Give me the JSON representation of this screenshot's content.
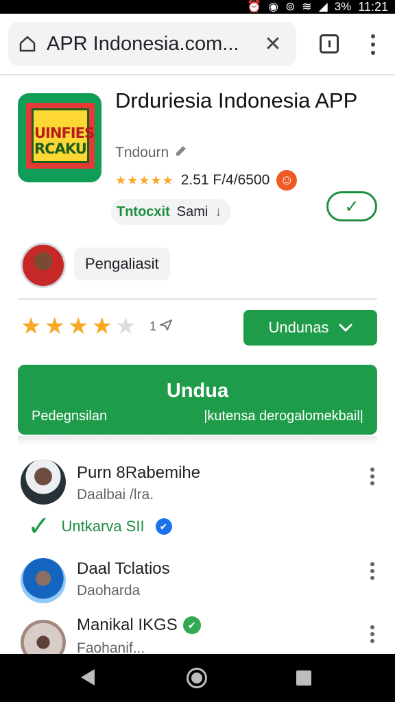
{
  "status_bar": {
    "time": "11:21",
    "battery": "3%",
    "icons": [
      "alarm-icon",
      "do-not-disturb-icon",
      "hotspot-icon",
      "wifi-icon",
      "signal-icon",
      "battery-icon"
    ]
  },
  "browser": {
    "url": "APR Indonesia.com...",
    "icons": [
      "home-icon",
      "close-icon",
      "tabs-icon",
      "more-vert-icon"
    ]
  },
  "app": {
    "icon_line1": "UINFIES",
    "icon_line2": "RCAKU",
    "title": "Drduriesia Indonesia APP",
    "developer": "Tndourn",
    "developer_icon": "edit-icon",
    "stars_small": "★★★★★",
    "rating_count": "2.51 F/4/6500",
    "badge_emoji": "☺",
    "install_chip_green": "Tntocxit",
    "install_chip_text": "Sami",
    "install_chip_arrow": "↓",
    "check_mark": "✓"
  },
  "profile": {
    "label": "Pengaliasit"
  },
  "rating": {
    "stars_filled": 4,
    "stars_total": 5,
    "review_count": "1",
    "review_icon": "send-icon",
    "dropdown_label": "Undunas",
    "dropdown_arrow": "⌄"
  },
  "banner": {
    "title": "Undua",
    "sub_left": "Pedegnsilan",
    "sub_right": "|kutensa derogalomekbail|"
  },
  "list": [
    {
      "name": "Purn 8Rabemihe",
      "sub": "Daalbai /lra."
    },
    {
      "name": "Daal Tclatios",
      "sub": "Daoharda"
    },
    {
      "name": "Manikal IKGS",
      "sub": "Faohanif..."
    }
  ],
  "verified": {
    "check": "✓",
    "text": "Untkarva SII",
    "badge": "✔"
  },
  "badge_green": "✔",
  "colors": {
    "accent_green": "#1e9c4a",
    "star": "#f9a825",
    "emoji_badge": "#ef5a24"
  }
}
